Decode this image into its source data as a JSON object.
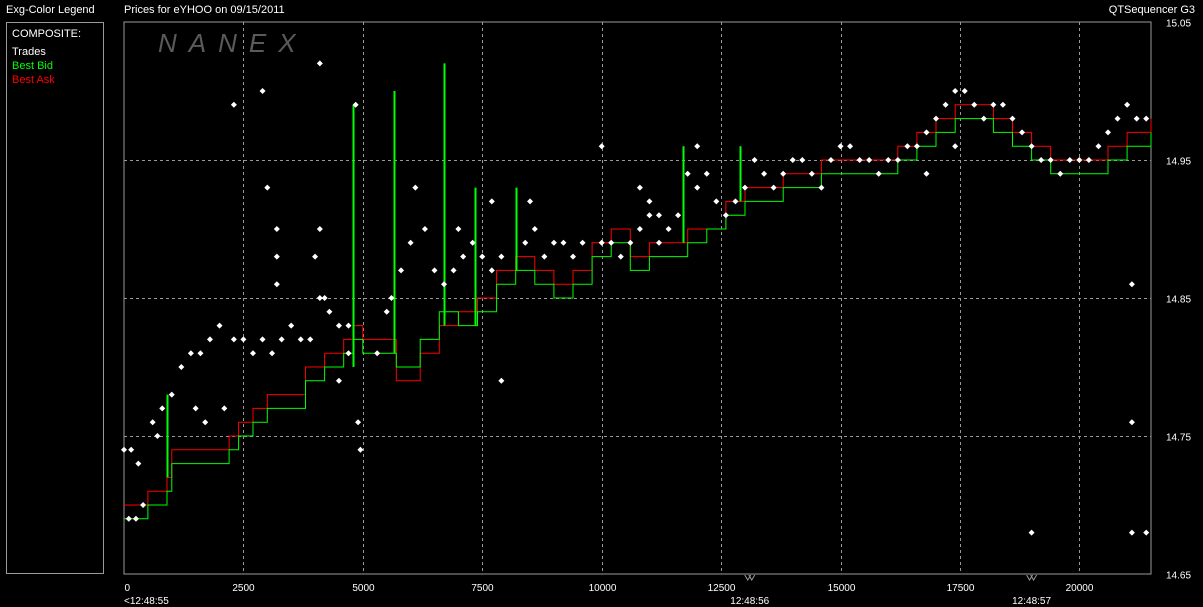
{
  "header": {
    "legend_title": "Exg-Color Legend",
    "chart_title": "Prices for  eYHOO  on  09/15/2011",
    "app_name": "QTSequencer G3"
  },
  "legend": {
    "heading": "COMPOSITE:",
    "items": [
      {
        "label": "Trades",
        "color": "#ffffff"
      },
      {
        "label": "Best Bid",
        "color": "#00ff00"
      },
      {
        "label": "Best Ask",
        "color": "#ff0000"
      }
    ]
  },
  "watermark": "NANEX",
  "chart_data": {
    "type": "line",
    "title": "Prices for  eYHOO  on  09/15/2011",
    "xlim": [
      0,
      21500
    ],
    "ylim": [
      14.65,
      15.05
    ],
    "x_ticks": [
      0,
      2500,
      5000,
      7500,
      10000,
      12500,
      15000,
      17500,
      20000
    ],
    "y_ticks": [
      14.65,
      14.75,
      14.85,
      14.95,
      15.05
    ],
    "y_tick_labels": [
      "14.65",
      "14.75",
      "14.85",
      "14.95",
      "15.05"
    ],
    "time_labels": [
      {
        "x": 0,
        "label": "<12:48:55"
      },
      {
        "x": 13100,
        "label": "12:48:56"
      },
      {
        "x": 19000,
        "label": "12:48:57"
      }
    ],
    "grid": true,
    "series": [
      {
        "name": "Best Bid",
        "color": "#00ff00",
        "step": true,
        "x": [
          0,
          500,
          900,
          1000,
          2200,
          2400,
          2700,
          3000,
          3400,
          3800,
          4200,
          4600,
          4800,
          5000,
          5700,
          6200,
          6600,
          7000,
          7400,
          7800,
          8200,
          8600,
          9000,
          9400,
          9800,
          10200,
          10600,
          11000,
          11400,
          11800,
          12200,
          12600,
          13000,
          13400,
          13800,
          14200,
          14600,
          15000,
          15400,
          15800,
          16200,
          16600,
          17000,
          17400,
          17800,
          18200,
          18600,
          19000,
          19400,
          19800,
          20200,
          20600,
          21000,
          21500
        ],
        "y": [
          14.69,
          14.7,
          14.71,
          14.73,
          14.74,
          14.75,
          14.76,
          14.77,
          14.77,
          14.79,
          14.8,
          14.81,
          14.82,
          14.81,
          14.8,
          14.82,
          14.84,
          14.83,
          14.84,
          14.86,
          14.87,
          14.86,
          14.85,
          14.86,
          14.88,
          14.89,
          14.87,
          14.88,
          14.88,
          14.89,
          14.9,
          14.91,
          14.92,
          14.92,
          14.93,
          14.93,
          14.94,
          14.94,
          14.94,
          14.94,
          14.95,
          14.96,
          14.97,
          14.98,
          14.98,
          14.97,
          14.96,
          14.95,
          14.94,
          14.94,
          14.94,
          14.95,
          14.96,
          14.97
        ]
      },
      {
        "name": "Best Ask",
        "color": "#ff0000",
        "step": true,
        "x": [
          0,
          500,
          900,
          1000,
          2200,
          2400,
          2700,
          3000,
          3400,
          3800,
          4200,
          4600,
          4800,
          5000,
          5700,
          6200,
          6600,
          7000,
          7400,
          7800,
          8200,
          8600,
          9000,
          9400,
          9800,
          10200,
          10600,
          11000,
          11400,
          11800,
          12200,
          12600,
          13000,
          13400,
          13800,
          14200,
          14600,
          15000,
          15400,
          15800,
          16200,
          16600,
          17000,
          17400,
          17800,
          18200,
          18600,
          19000,
          19400,
          19800,
          20200,
          20600,
          21000,
          21500
        ],
        "y": [
          14.7,
          14.71,
          14.72,
          14.74,
          14.75,
          14.76,
          14.77,
          14.78,
          14.78,
          14.8,
          14.81,
          14.82,
          14.83,
          14.82,
          14.79,
          14.81,
          14.83,
          14.84,
          14.85,
          14.87,
          14.88,
          14.87,
          14.86,
          14.87,
          14.89,
          14.9,
          14.88,
          14.89,
          14.89,
          14.9,
          14.9,
          14.92,
          14.93,
          14.93,
          14.94,
          14.94,
          14.95,
          14.95,
          14.95,
          14.95,
          14.96,
          14.97,
          14.98,
          14.99,
          14.99,
          14.98,
          14.97,
          14.96,
          14.95,
          14.95,
          14.95,
          14.96,
          14.97,
          14.98
        ]
      }
    ],
    "spikes": {
      "color": "#00ff00",
      "x": [
        900,
        4800,
        5650,
        6700,
        7350,
        8200,
        11700,
        12900
      ],
      "low": [
        14.72,
        14.8,
        14.81,
        14.83,
        14.83,
        14.87,
        14.89,
        14.92
      ],
      "high": [
        14.78,
        14.99,
        15.0,
        15.02,
        14.93,
        14.93,
        14.96,
        14.96
      ]
    },
    "trades": {
      "name": "Trades",
      "color": "#ffffff",
      "points": [
        [
          0,
          14.74
        ],
        [
          150,
          14.74
        ],
        [
          300,
          14.73
        ],
        [
          100,
          14.69
        ],
        [
          250,
          14.69
        ],
        [
          400,
          14.7
        ],
        [
          600,
          14.76
        ],
        [
          800,
          14.77
        ],
        [
          700,
          14.75
        ],
        [
          1000,
          14.78
        ],
        [
          1200,
          14.8
        ],
        [
          1400,
          14.81
        ],
        [
          1600,
          14.81
        ],
        [
          1800,
          14.82
        ],
        [
          2000,
          14.83
        ],
        [
          1500,
          14.77
        ],
        [
          1700,
          14.76
        ],
        [
          2100,
          14.77
        ],
        [
          2300,
          14.82
        ],
        [
          2500,
          14.82
        ],
        [
          2700,
          14.81
        ],
        [
          2900,
          14.82
        ],
        [
          3100,
          14.81
        ],
        [
          3300,
          14.82
        ],
        [
          3500,
          14.83
        ],
        [
          3700,
          14.82
        ],
        [
          3900,
          14.82
        ],
        [
          4100,
          14.85
        ],
        [
          4300,
          14.84
        ],
        [
          4500,
          14.83
        ],
        [
          4700,
          14.83
        ],
        [
          3200,
          14.9
        ],
        [
          3200,
          14.88
        ],
        [
          3200,
          14.86
        ],
        [
          4000,
          14.88
        ],
        [
          4100,
          14.9
        ],
        [
          4200,
          14.85
        ],
        [
          2300,
          14.99
        ],
        [
          3000,
          14.93
        ],
        [
          2900,
          15.0
        ],
        [
          4100,
          15.02
        ],
        [
          4850,
          14.99
        ],
        [
          4500,
          14.79
        ],
        [
          4700,
          14.81
        ],
        [
          4900,
          14.76
        ],
        [
          4950,
          14.74
        ],
        [
          5300,
          14.81
        ],
        [
          5500,
          14.84
        ],
        [
          5600,
          14.85
        ],
        [
          5800,
          14.87
        ],
        [
          6000,
          14.89
        ],
        [
          6100,
          14.93
        ],
        [
          6300,
          14.9
        ],
        [
          6500,
          14.87
        ],
        [
          6700,
          14.86
        ],
        [
          6900,
          14.87
        ],
        [
          7100,
          14.88
        ],
        [
          7300,
          14.89
        ],
        [
          7500,
          14.88
        ],
        [
          7700,
          14.87
        ],
        [
          7900,
          14.88
        ],
        [
          7000,
          14.9
        ],
        [
          7700,
          14.92
        ],
        [
          8400,
          14.89
        ],
        [
          8600,
          14.9
        ],
        [
          8800,
          14.88
        ],
        [
          9000,
          14.89
        ],
        [
          9200,
          14.89
        ],
        [
          9400,
          14.88
        ],
        [
          9600,
          14.89
        ],
        [
          8500,
          14.92
        ],
        [
          7900,
          14.79
        ],
        [
          10000,
          14.89
        ],
        [
          10200,
          14.89
        ],
        [
          10400,
          14.88
        ],
        [
          10600,
          14.89
        ],
        [
          10800,
          14.9
        ],
        [
          11000,
          14.91
        ],
        [
          11200,
          14.89
        ],
        [
          11400,
          14.9
        ],
        [
          11600,
          14.91
        ],
        [
          10000,
          14.96
        ],
        [
          10800,
          14.93
        ],
        [
          11000,
          14.92
        ],
        [
          11200,
          14.91
        ],
        [
          11800,
          14.94
        ],
        [
          12000,
          14.93
        ],
        [
          12200,
          14.94
        ],
        [
          12000,
          14.96
        ],
        [
          12400,
          14.92
        ],
        [
          12600,
          14.91
        ],
        [
          12800,
          14.92
        ],
        [
          13000,
          14.93
        ],
        [
          13200,
          14.95
        ],
        [
          13400,
          14.94
        ],
        [
          13600,
          14.93
        ],
        [
          13800,
          14.94
        ],
        [
          14000,
          14.95
        ],
        [
          14200,
          14.95
        ],
        [
          14400,
          14.94
        ],
        [
          14600,
          14.93
        ],
        [
          14800,
          14.95
        ],
        [
          15000,
          14.96
        ],
        [
          15200,
          14.96
        ],
        [
          15400,
          14.95
        ],
        [
          15600,
          14.95
        ],
        [
          15800,
          14.94
        ],
        [
          16000,
          14.95
        ],
        [
          16200,
          14.95
        ],
        [
          16400,
          14.96
        ],
        [
          16600,
          14.96
        ],
        [
          16800,
          14.97
        ],
        [
          17000,
          14.98
        ],
        [
          17200,
          14.99
        ],
        [
          17400,
          15.0
        ],
        [
          17600,
          15.0
        ],
        [
          17800,
          14.99
        ],
        [
          18000,
          14.98
        ],
        [
          18200,
          14.99
        ],
        [
          18400,
          14.99
        ],
        [
          18600,
          14.98
        ],
        [
          18800,
          14.97
        ],
        [
          19000,
          14.96
        ],
        [
          19200,
          14.95
        ],
        [
          19400,
          14.95
        ],
        [
          19600,
          14.94
        ],
        [
          19800,
          14.95
        ],
        [
          20000,
          14.95
        ],
        [
          20200,
          14.95
        ],
        [
          20400,
          14.96
        ],
        [
          20600,
          14.97
        ],
        [
          20800,
          14.98
        ],
        [
          21000,
          14.99
        ],
        [
          21200,
          14.98
        ],
        [
          21400,
          14.98
        ],
        [
          17400,
          14.96
        ],
        [
          16800,
          14.94
        ],
        [
          21100,
          14.86
        ],
        [
          21100,
          14.76
        ],
        [
          19000,
          14.68
        ],
        [
          21100,
          14.68
        ],
        [
          21400,
          14.68
        ]
      ]
    }
  }
}
